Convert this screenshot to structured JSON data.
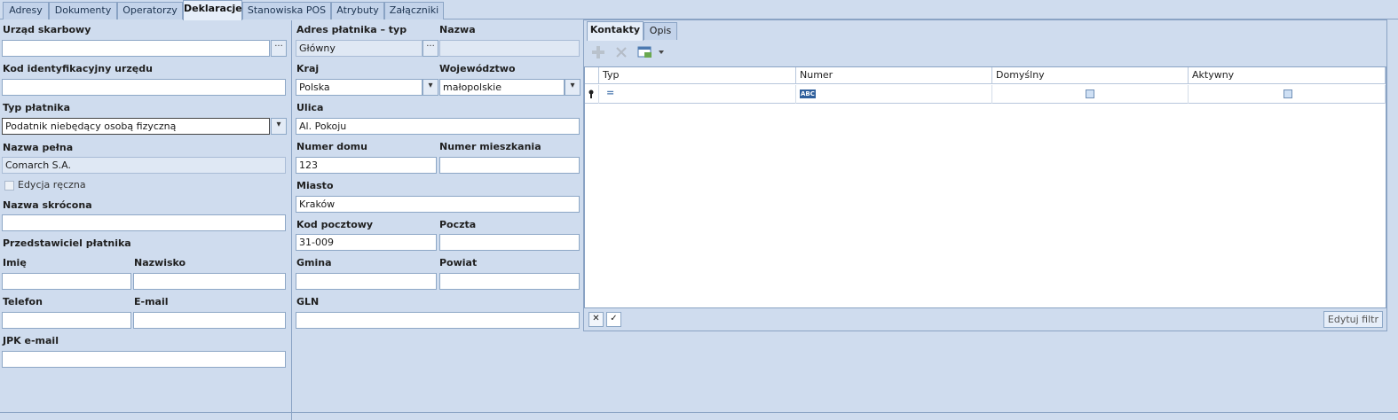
{
  "tabs": [
    "Adresy",
    "Dokumenty",
    "Operatorzy",
    "Deklaracje",
    "Stanowiska POS",
    "Atrybuty",
    "Załączniki"
  ],
  "active_tab": "Deklaracje",
  "left": {
    "urzad_skarbowy": {
      "label": "Urząd skarbowy",
      "value": ""
    },
    "kod_urzedu": {
      "label": "Kod identyfikacyjny urzędu",
      "value": ""
    },
    "typ_platnika": {
      "label": "Typ płatnika",
      "value": "Podatnik niebędący osobą fizyczną"
    },
    "nazwa_pelna": {
      "label": "Nazwa pełna",
      "value": "Comarch S.A."
    },
    "edycja_reczna": {
      "label": "Edycja ręczna",
      "checked": false
    },
    "nazwa_skrocona": {
      "label": "Nazwa skrócona",
      "value": ""
    },
    "przedstawiciel": {
      "label": "Przedstawiciel płatnika"
    },
    "imie": {
      "label": "Imię",
      "value": ""
    },
    "nazwisko": {
      "label": "Nazwisko",
      "value": ""
    },
    "telefon": {
      "label": "Telefon",
      "value": ""
    },
    "email": {
      "label": "E-mail",
      "value": ""
    },
    "jpk_email": {
      "label": "JPK e-mail",
      "value": ""
    }
  },
  "middle": {
    "adres_typ": {
      "label": "Adres płatnika – typ",
      "value": "Główny"
    },
    "nazwa": {
      "label": "Nazwa",
      "value": ""
    },
    "kraj": {
      "label": "Kraj",
      "value": "Polska"
    },
    "wojewodztwo": {
      "label": "Województwo",
      "value": "małopolskie"
    },
    "ulica": {
      "label": "Ulica",
      "value": "Al. Pokoju"
    },
    "numer_domu": {
      "label": "Numer domu",
      "value": "123"
    },
    "numer_mieszkania": {
      "label": "Numer mieszkania",
      "value": ""
    },
    "miasto": {
      "label": "Miasto",
      "value": "Kraków"
    },
    "kod_pocztowy": {
      "label": "Kod pocztowy",
      "value": "31-009"
    },
    "poczta": {
      "label": "Poczta",
      "value": ""
    },
    "gmina": {
      "label": "Gmina",
      "value": ""
    },
    "powiat": {
      "label": "Powiat",
      "value": ""
    },
    "gln": {
      "label": "GLN",
      "value": ""
    }
  },
  "panel": {
    "tabs": [
      "Kontakty",
      "Opis"
    ],
    "active_tab": "Kontakty",
    "columns": [
      "Typ",
      "Numer",
      "Domyślny",
      "Aktywny"
    ],
    "filter_row": {
      "typ": "=",
      "numer": "ABC"
    },
    "edit_filter_label": "Edytuj filtr"
  }
}
